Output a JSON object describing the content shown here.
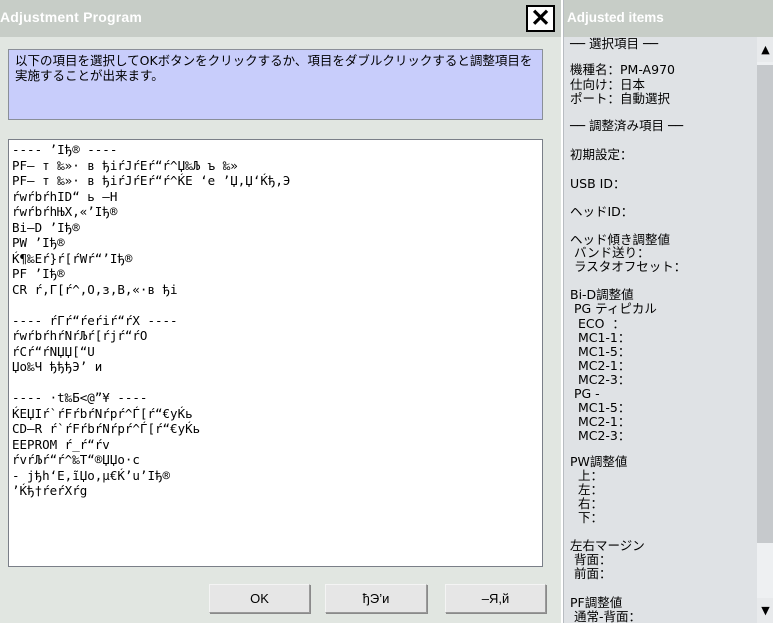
{
  "left_window": {
    "title": "Adjustment Program",
    "close_label": "✕",
    "instructions": "以下の項目を選択してOKボタンをクリックするか、項目をダブルクリックすると調整項目を実施することが出来ます。",
    "list_items": [
      "---- ’Iђ® ----",
      "PF– т ‰»· в ђiŕJŕEŕ“ŕ^Џ‰Љ ъ ‰»",
      "PF– т ‰»· в ђiŕJŕEŕ“ŕ^ЌЕ ‘е ’Џ,Џ‘Ќђ,Э",
      "ŕwŕbŕhID“ ь –Н",
      "ŕwŕbŕhЊX,«’Iђ®",
      "Bi–D ’Iђ®",
      "PW ’Iђ®",
      "Ќ¶‰Eŕ}ŕ[ŕWŕ“’Iђ®",
      "PF ’Iђ®",
      "CR ŕ,Г[ŕ^,О,з,В,«·в ђi",
      "",
      "---- ŕГŕ“ŕeŕiŕ“ŕX ----",
      "ŕwŕbŕhŕNŕЉŕ[ŕjŕ“ŕO",
      "ŕCŕ“ŕNЏЏ[“U",
      "Џo‰Ч ђђђЭ’ и",
      "",
      "---- ·t‰Б<@”¥ ----",
      "ЌЕЏIŕ`ŕFŕbŕNŕpŕ^Ѓ[ŕ“€уЌь",
      "CD–R ŕ`ŕFŕbŕNŕpŕ^Ѓ[ŕ“€уЌь",
      "EEPROM ŕ_ŕ“ŕv",
      "ŕvŕЉŕ“ŕ^‰Т“®ЏЏо·с",
      "- јђh‘Е,ĩЏo,µ€Ќ’u’Iђ®",
      "’Ќђ†ŕeŕXŕg"
    ],
    "buttons": {
      "ok": "OK",
      "second": "ђЭ’и",
      "third": "–Я,й"
    }
  },
  "right_window": {
    "title": "Adjusted items",
    "lines": [
      "── 選択項目 ──",
      "",
      "機種名：PM-A970",
      "仕向け：日本",
      "ポート：自動選択",
      "",
      "── 調整済み項目 ──",
      "",
      "初期設定：",
      "",
      "USB ID：",
      "",
      "ヘッドID：",
      "",
      "ヘッド傾き調整値",
      " バンド送り：",
      " ラスタオフセット：",
      "",
      "Bi-D調整値",
      " PG ティピカル",
      "  ECO  ：",
      "  MC1-1：",
      "  MC1-5：",
      "  MC2-1：",
      "  MC2-3：",
      " PG -",
      "  MC1-5：",
      "  MC2-1：",
      "  MC2-3：",
      "",
      "PW調整値",
      "  上：",
      "  左：",
      "  右：",
      "  下：",
      "",
      "左右マージン",
      " 背面：",
      " 前面：",
      "",
      "PF調整値",
      " 通常-背面："
    ],
    "scroll_up_icon": "▲",
    "scroll_down_icon": "▼"
  }
}
